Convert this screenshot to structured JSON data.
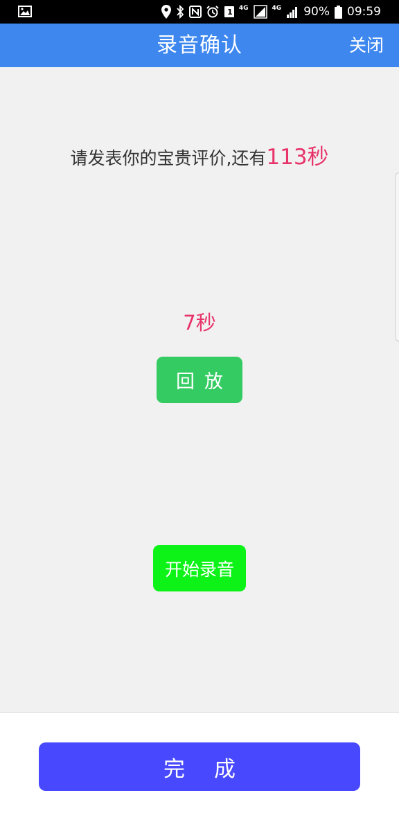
{
  "status_bar": {
    "battery": "90%",
    "time": "09:59",
    "network_label_1": "4G",
    "network_label_2": "4G",
    "sim_slot": "1",
    "icons": [
      "image-icon",
      "location-icon",
      "bluetooth-icon",
      "nfc-icon",
      "alarm-icon",
      "sim-icon",
      "signal-icon",
      "battery-icon"
    ]
  },
  "app_bar": {
    "title": "录音确认",
    "close_label": "关闭",
    "background": "#3d87ef"
  },
  "main": {
    "prompt_text": "请发表你的宝贵评价,还有",
    "remaining_count": "113秒",
    "recorded_duration": "7秒",
    "playback_button_label": "回放",
    "record_button_label": "开始录音"
  },
  "footer": {
    "done_button_label": "完成"
  },
  "colors": {
    "accent_red": "#e8336a",
    "playback_green": "#35cb63",
    "record_green": "#0df318",
    "done_blue": "#4849fe"
  }
}
